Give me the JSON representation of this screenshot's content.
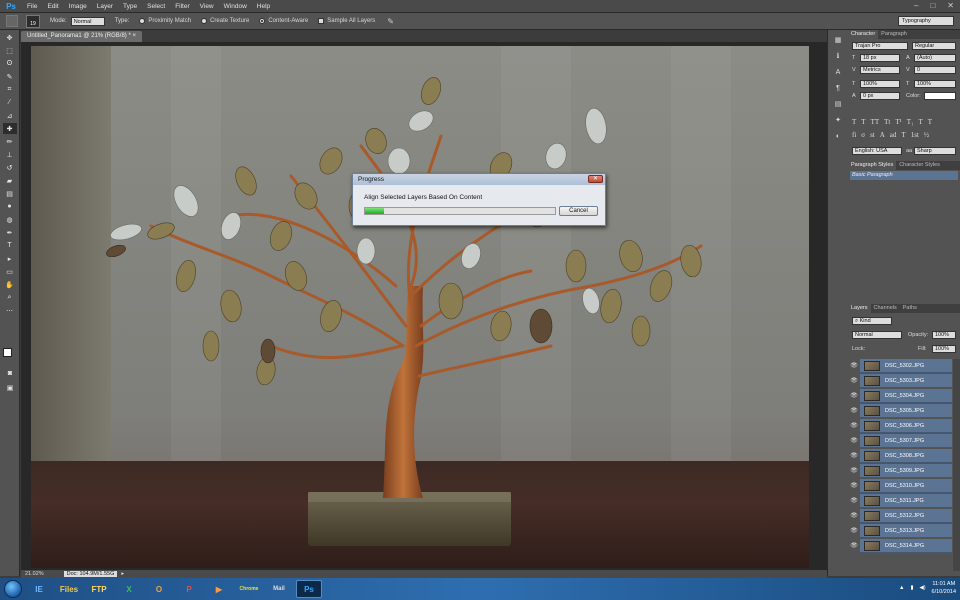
{
  "app": {
    "logo": "Ps",
    "workspace": "Typography"
  },
  "menu": [
    "File",
    "Edit",
    "Image",
    "Layer",
    "Type",
    "Select",
    "Filter",
    "View",
    "Window",
    "Help"
  ],
  "window_controls": [
    "–",
    "□",
    "✕"
  ],
  "options": {
    "brush_size": "19",
    "mode_label": "Mode:",
    "mode_value": "Normal",
    "type_label": "Type:",
    "type_options": [
      "Proximity Match",
      "Create Texture",
      "Content-Aware"
    ],
    "type_selected": "Content-Aware",
    "sample_all": "Sample All Layers"
  },
  "document": {
    "tab_title": "Untitled_Panorama1 @ 21% (RGB/8) *",
    "zoom": "21.02%",
    "doc_size": "Doc: 104.9M/1.55G"
  },
  "dialog": {
    "title": "Progress",
    "message": "Align Selected Layers Based On Content",
    "progress": 0.1,
    "cancel": "Cancel",
    "close_glyph": "✕"
  },
  "character": {
    "tabs": [
      "Character",
      "Paragraph"
    ],
    "font_family": "Trajan Pro",
    "font_style": "Regular",
    "size": "18 px",
    "leading": "(Auto)",
    "kerning": "Metrics",
    "tracking": "0",
    "vscale": "100%",
    "hscale": "100%",
    "baseline": "0 px",
    "color_label": "Color:",
    "glyphs": [
      "T",
      "T",
      "TT",
      "Tt",
      "T¹",
      "T₁",
      "T",
      "T"
    ],
    "extras": [
      "fi",
      "σ",
      "st",
      "A",
      "ad",
      "T",
      "1st",
      "½"
    ],
    "language": "English: USA",
    "aa_label": "aa",
    "antialias": "Sharp"
  },
  "styles": {
    "tabs": [
      "Paragraph Styles",
      "Character Styles"
    ],
    "items": [
      "Basic Paragraph"
    ]
  },
  "layers": {
    "tabs": [
      "Layers",
      "Channels",
      "Paths"
    ],
    "kind_label": "Kind",
    "blend_mode": "Normal",
    "opacity_label": "Opacity:",
    "opacity": "100%",
    "lock_label": "Lock:",
    "fill_label": "Fill:",
    "fill": "100%",
    "items": [
      "DSC_5302.JPG",
      "DSC_5303.JPG",
      "DSC_5304.JPG",
      "DSC_5305.JPG",
      "DSC_5306.JPG",
      "DSC_5307.JPG",
      "DSC_5308.JPG",
      "DSC_5309.JPG",
      "DSC_5310.JPG",
      "DSC_5311.JPG",
      "DSC_5312.JPG",
      "DSC_5313.JPG",
      "DSC_5314.JPG"
    ]
  },
  "taskbar": {
    "apps": [
      "IE",
      "Files",
      "FTP",
      "X",
      "O",
      "P",
      "▶",
      "Chrome",
      "Mail",
      "Ps"
    ],
    "time": "11:01 AM",
    "date": "6/10/2014"
  },
  "colors": {
    "accent": "#31a8ff",
    "selected_layer": "#5c7494",
    "progress_green": "#1fae1a"
  }
}
